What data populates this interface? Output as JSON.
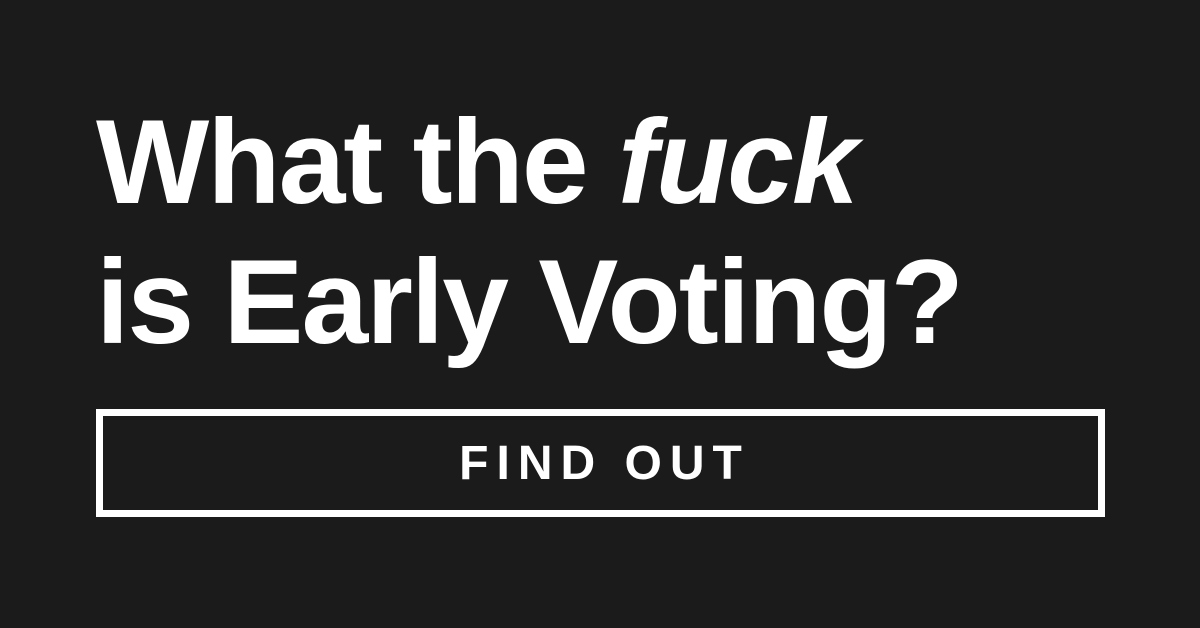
{
  "headline": {
    "line1_prefix": "What the ",
    "line1_emphasis": "fuck",
    "line2": "is Early Voting?"
  },
  "cta": {
    "label": "FIND OUT"
  },
  "colors": {
    "background": "#1b1b1b",
    "foreground": "#ffffff"
  }
}
